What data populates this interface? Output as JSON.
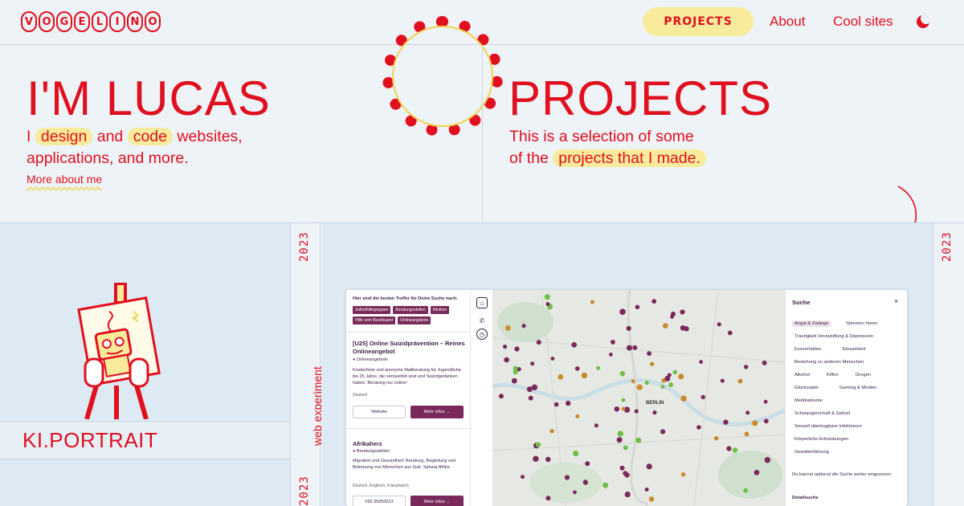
{
  "nav": {
    "logo_letters": [
      "V",
      "O",
      "G",
      "E",
      "L",
      "I",
      "N",
      "O"
    ],
    "projects_label": "PROJECTS",
    "about_label": "About",
    "cool_sites_label": "Cool sites"
  },
  "hero_left": {
    "title": "I'M LUCAS",
    "line1_a": "I",
    "line1_hl1": "design",
    "line1_b": "and",
    "line1_hl2": "code",
    "line1_c": "websites,",
    "line2": "applications, and more.",
    "more_link": "More about me"
  },
  "hero_right": {
    "title": "PROJECTS",
    "line1": "This is a selection of some",
    "line2_a": "of the",
    "line2_hl": "projects that I made."
  },
  "project": {
    "year_left": "2023",
    "year_right": "2023",
    "year_next": "2023",
    "type": "web experiment",
    "left_title": "KI.PORTRAIT"
  },
  "mock": {
    "list_head": "Hier sind die besten Treffer für Deine Suche nach:",
    "tags": [
      "Selbsthilfegruppen",
      "Beratungsstellen",
      "Kliniken",
      "Hilfe vom Bezirksamt",
      "Onlineangebote"
    ],
    "card1": {
      "title": "[U25] Online Suizidprävention – Reines Onlineangebot",
      "category": "Onlineangebote",
      "desc": "Kostenfreie und anonyme Mailberatung für Jugendliche bis 25 Jahre, die verzweifelt sind und Suizidgedanken haben. Beratung nur online!",
      "lang": "Deutsch",
      "btn_website": "Website",
      "btn_more": "Mehr Infos →"
    },
    "card2": {
      "title": "Afrikaherz",
      "category": "Beratungsstellen",
      "desc": "Migration und Gesundheit: Beratung, Begleitung und Betreuung von Menschen aus Sub- Sahara Afrika",
      "lang": "Deutsch, Englisch, Französisch",
      "btn_phone": "030 35050013",
      "btn_more": "Mehr Infos →"
    },
    "map_label": "BERLIN",
    "search_title": "Suche",
    "close_icon": "×",
    "chips": [
      "Angst & Zwänge",
      "Stimmen hören",
      "Traurigkeit Verzweiflung & Depression",
      "Essverhalten",
      "Einsamkeit",
      "Beziehung zu anderen Menschen",
      "Alkohol",
      "Kiffen",
      "Drogen",
      "Glücksspiel",
      "Gaming & Medien",
      "Medikamente",
      "Schwangerschaft & Geburt",
      "Sexuell übertragbare Infektionen",
      "Körperliche Erkrankungen",
      "Gewalterfahrung"
    ],
    "note": "Du kannst optional die Suche weiter eingrenzen:",
    "detail": "Detailsuche"
  },
  "colors": {
    "accent": "#e0101f",
    "highlight": "#f8ec9c",
    "background": "#eef3f7",
    "panel": "#dde9f3",
    "mock_primary": "#7a2a5a"
  }
}
